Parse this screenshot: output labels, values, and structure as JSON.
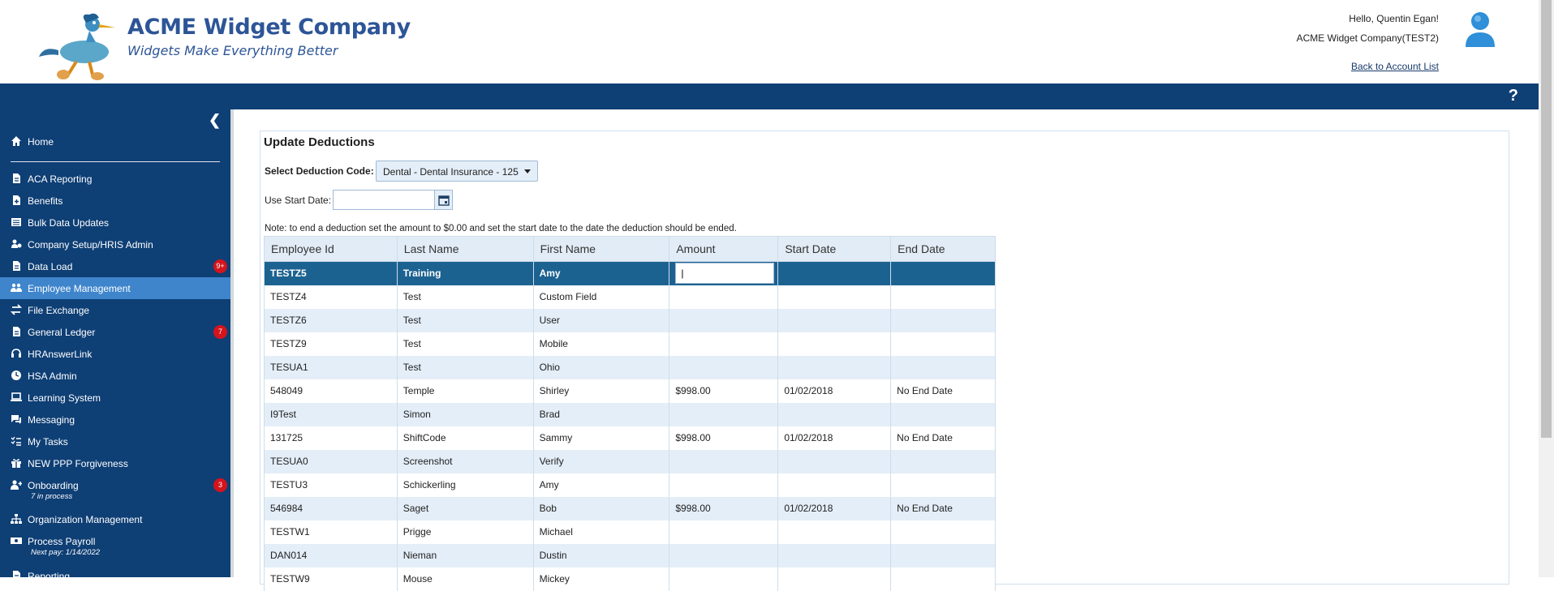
{
  "header": {
    "brand_title": "ACME Widget Company",
    "brand_tagline": "Widgets Make Everything Better",
    "greeting": "Hello, Quentin Egan!",
    "company": "ACME Widget Company(TEST2)",
    "back_link": "Back to Account List",
    "help_label": "?"
  },
  "sidebar": {
    "items": [
      {
        "label": "Home",
        "icon": "home-icon"
      },
      {
        "label": "ACA Reporting",
        "icon": "document-icon"
      },
      {
        "label": "Benefits",
        "icon": "document-plus-icon"
      },
      {
        "label": "Bulk Data Updates",
        "icon": "list-icon"
      },
      {
        "label": "Company Setup/HRIS Admin",
        "icon": "users-gear-icon"
      },
      {
        "label": "Data Load",
        "icon": "document-icon",
        "badge": "9+"
      },
      {
        "label": "Employee Management",
        "icon": "users-icon",
        "active": true
      },
      {
        "label": "File Exchange",
        "icon": "exchange-icon"
      },
      {
        "label": "General Ledger",
        "icon": "document-icon",
        "badge": "7"
      },
      {
        "label": "HRAnswerLink",
        "icon": "headset-icon"
      },
      {
        "label": "HSA Admin",
        "icon": "clock-icon"
      },
      {
        "label": "Learning System",
        "icon": "laptop-icon"
      },
      {
        "label": "Messaging",
        "icon": "chat-icon"
      },
      {
        "label": "My Tasks",
        "icon": "tasks-icon"
      },
      {
        "label": "NEW PPP Forgiveness",
        "icon": "gift-icon"
      },
      {
        "label": "Onboarding",
        "icon": "user-plus-icon",
        "badge": "3",
        "sub": "7 in process"
      },
      {
        "label": "Organization Management",
        "icon": "sitemap-icon"
      },
      {
        "label": "Process Payroll",
        "icon": "money-icon",
        "sub": "Next pay: 1/14/2022"
      },
      {
        "label": "Reporting",
        "icon": "document-icon"
      }
    ]
  },
  "main": {
    "title": "Update Deductions",
    "deduction_label": "Select Deduction Code:",
    "deduction_value": "Dental - Dental Insurance - 125",
    "start_date_label": "Use Start Date:",
    "start_date_value": "",
    "note": "Note: to end a deduction set the amount to $0.00 and set the start date to the date the deduction should be ended."
  },
  "table": {
    "columns": [
      "Employee Id",
      "Last Name",
      "First Name",
      "Amount",
      "Start Date",
      "End Date"
    ],
    "rows": [
      [
        "TESTZ5",
        "Training",
        "Amy",
        "",
        "",
        ""
      ],
      [
        "TESTZ4",
        "Test",
        "Custom Field",
        "",
        "",
        ""
      ],
      [
        "TESTZ6",
        "Test",
        "User",
        "",
        "",
        ""
      ],
      [
        "TESTZ9",
        "Test",
        "Mobile",
        "",
        "",
        ""
      ],
      [
        "TESUA1",
        "Test",
        "Ohio",
        "",
        "",
        ""
      ],
      [
        "548049",
        "Temple",
        "Shirley",
        "$998.00",
        "01/02/2018",
        "No End Date"
      ],
      [
        "I9Test",
        "Simon",
        "Brad",
        "",
        "",
        ""
      ],
      [
        "131725",
        "ShiftCode",
        "Sammy",
        "$998.00",
        "01/02/2018",
        "No End Date"
      ],
      [
        "TESUA0",
        "Screenshot",
        "Verify",
        "",
        "",
        ""
      ],
      [
        "TESTU3",
        "Schickerling",
        "Amy",
        "",
        "",
        ""
      ],
      [
        "546984",
        "Saget",
        "Bob",
        "$998.00",
        "01/02/2018",
        "No End Date"
      ],
      [
        "TESTW1",
        "Prigge",
        "Michael",
        "",
        "",
        ""
      ],
      [
        "DAN014",
        "Nieman",
        "Dustin",
        "",
        "",
        ""
      ],
      [
        "TESTW9",
        "Mouse",
        "Mickey",
        "",
        "",
        ""
      ]
    ],
    "selected_amount_value": "|"
  }
}
